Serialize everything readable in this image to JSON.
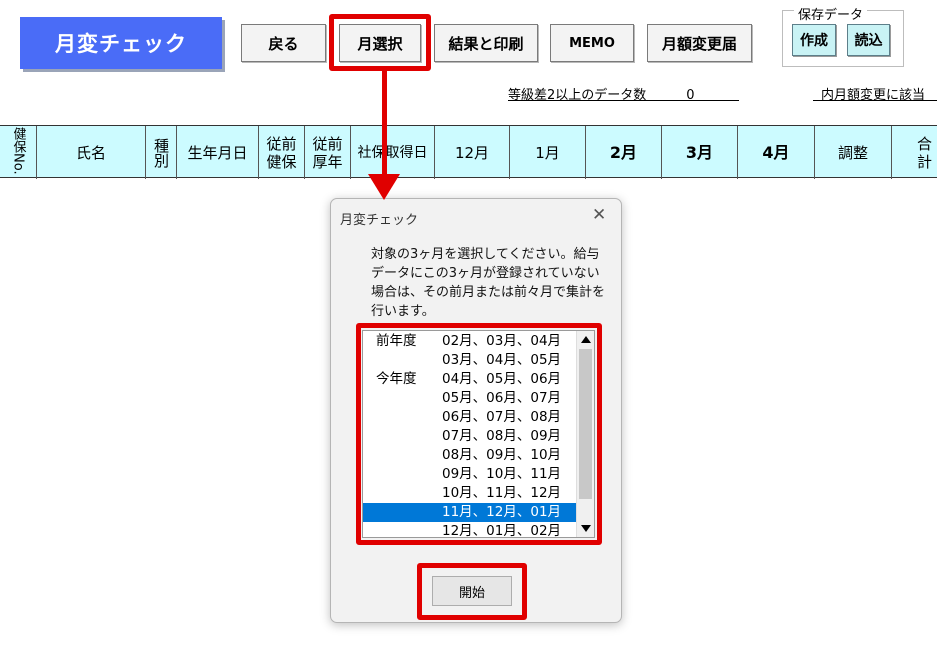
{
  "app": {
    "title": "月変チェック"
  },
  "toolbar": {
    "back": "戻る",
    "month_select": "月選択",
    "results_print": "結果と印刷",
    "memo": "MEMO",
    "monthly_change_notice": "月額変更届"
  },
  "save_data": {
    "label": "保存データ",
    "create": "作成",
    "load": "読込"
  },
  "summary": {
    "grade_diff_label": "等級差2以上のデータ数",
    "grade_diff_count": "0",
    "monthly_change_label": "内月額変更に該当"
  },
  "table": {
    "headers": [
      "健保No.",
      "氏名",
      "種別",
      "生年月日",
      "従前健保",
      "従前厚年",
      "社保取得日",
      "12月",
      "1月",
      "2月",
      "3月",
      "4月",
      "調整",
      "合計"
    ]
  },
  "dialog": {
    "title": "月変チェック",
    "close": "✕",
    "message": "対象の3ヶ月を選択してください。給与データにこの3ヶ月が登録されていない場合は、その前月または前々月で集計を行います。",
    "start_button": "開始",
    "selected_index": 9,
    "options": [
      {
        "group": "前年度",
        "months": "02月、03月、04月"
      },
      {
        "group": "",
        "months": "03月、04月、05月"
      },
      {
        "group": "今年度",
        "months": "04月、05月、06月"
      },
      {
        "group": "",
        "months": "05月、06月、07月"
      },
      {
        "group": "",
        "months": "06月、07月、08月"
      },
      {
        "group": "",
        "months": "07月、08月、09月"
      },
      {
        "group": "",
        "months": "08月、09月、10月"
      },
      {
        "group": "",
        "months": "09月、10月、11月"
      },
      {
        "group": "",
        "months": "10月、11月、12月"
      },
      {
        "group": "",
        "months": "11月、12月、01月"
      },
      {
        "group": "",
        "months": "12月、01月、02月"
      }
    ]
  },
  "colors": {
    "title_bg": "#4a6cf7",
    "header_bg": "#ccfbff",
    "highlight": "#e00000",
    "selection": "#0078d7",
    "save_button_bg": "#c9f3f5"
  }
}
